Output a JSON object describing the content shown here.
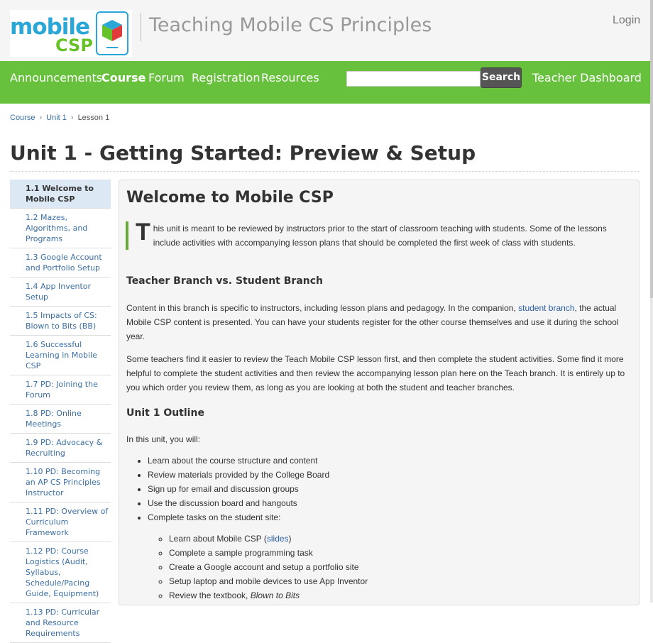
{
  "header": {
    "logo_word1": "mobile",
    "logo_word2": "CSP",
    "site_title": "Teaching Mobile CS Principles",
    "login": "Login"
  },
  "nav": {
    "items": [
      "Announcements",
      "Course",
      "Forum",
      "Registration",
      "Resources"
    ],
    "search_value": "",
    "search_button": "Search",
    "teacher_dashboard": "Teacher Dashboard"
  },
  "breadcrumb": {
    "items": [
      "Course",
      "Unit 1",
      "Lesson 1"
    ],
    "separator": "›"
  },
  "page_title": "Unit 1 - Getting Started: Preview & Setup",
  "sidebar": {
    "items": [
      "1.1 Welcome to Mobile CSP",
      "1.2 Mazes, Algorithms, and Programs",
      "1.3 Google Account and Portfolio Setup",
      "1.4 App Inventor Setup",
      "1.5 Impacts of CS: Blown to Bits (BB)",
      "1.6 Successful Learning in Mobile CSP",
      "1.7 PD: Joining the Forum",
      "1.8 PD: Online Meetings",
      "1.9 PD: Advocacy & Recruiting",
      "1.10 PD: Becoming an AP CS Principles Instructor",
      "1.11 PD: Overview of Curriculum Framework",
      "1.12 PD: Course Logistics (Audit, Syllabus, Schedule/Pacing Guide, Equipment)",
      "1.13 PD: Curricular and Resource Requirements"
    ]
  },
  "content": {
    "heading": "Welcome to Mobile CSP",
    "intro_dropcap": "T",
    "intro_text": "his unit is meant to be reviewed by instructors prior to the start of classroom teaching with students. Some of the lessons include activities with accompanying lesson plans that should be completed the first week of class with students.",
    "section1_heading": "Teacher Branch vs. Student Branch",
    "para1_before": "Content in this branch is specific to instructors, including lesson plans and pedagogy. In the companion, ",
    "para1_link": "student branch",
    "para1_after": ", the actual Mobile CSP content is presented. You can have your students register for the other course themselves and use it during the school year.",
    "para2": "Some teachers find it easier to review the Teach Mobile CSP lesson first, and then complete the student activities. Some find it more helpful to complete the student activities and then review the accompanying lesson plan here on the Teach branch. It is entirely up to you which order you review them, as long as you are looking at both the student and teacher branches.",
    "section2_heading": "Unit 1 Outline",
    "outline_intro": "In this unit, you will:",
    "outline_items": [
      "Learn about the course structure and content",
      "Review materials provided by the College Board",
      "Sign up for email and discussion groups",
      "Use the discussion board and hangouts",
      "Complete tasks on the student site:"
    ],
    "sub_item1_before": "Learn about Mobile CSP (",
    "sub_item1_link": "slides",
    "sub_item1_after": ")",
    "sub_items": [
      "Complete a sample programming task",
      "Create a Google account and setup a portfolio site",
      "Setup laptop and mobile devices to use App Inventor"
    ],
    "sub_item_last_before": "Review the textbook, ",
    "sub_item_last_italic": "Blown to Bits"
  },
  "colors": {
    "nav_green": "#67c13c",
    "logo_blue": "#2aa7d6",
    "logo_green": "#67c22a",
    "link_blue": "#3b6fa3",
    "active_bg": "#dce9f5"
  }
}
